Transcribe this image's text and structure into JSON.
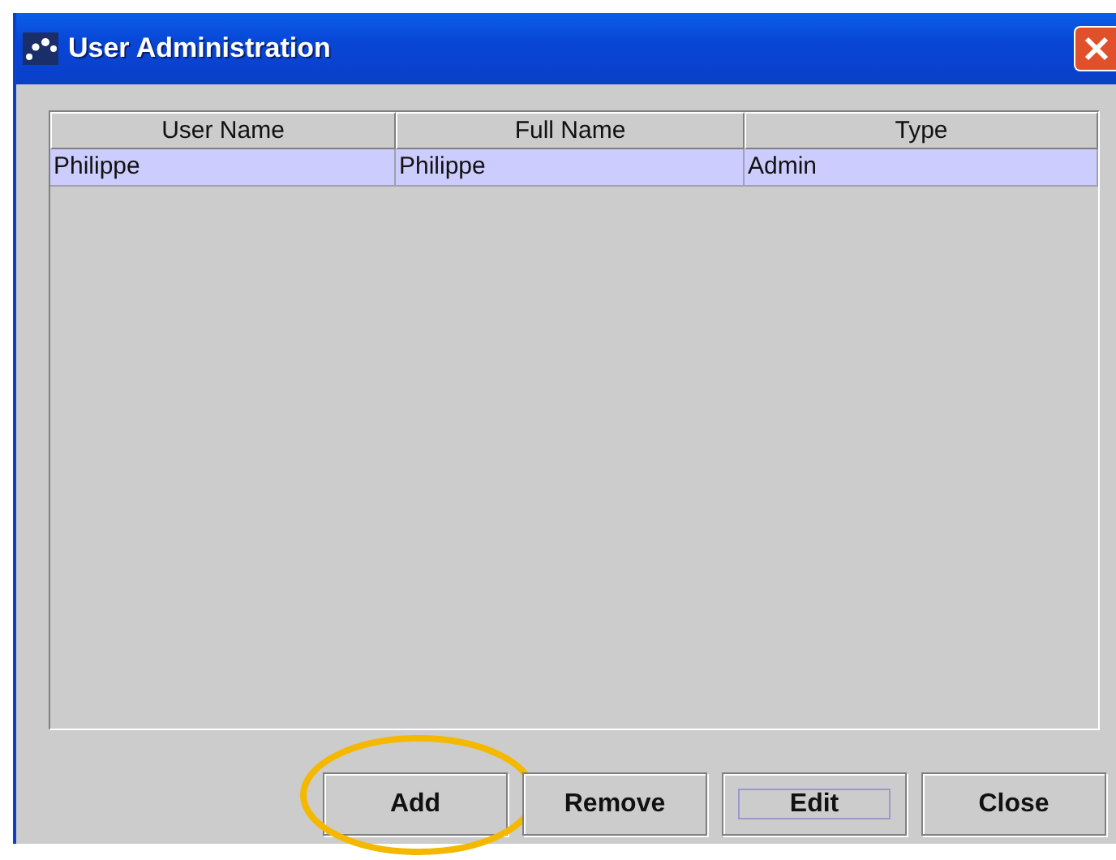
{
  "window": {
    "title": "User Administration"
  },
  "table": {
    "columns": [
      "User Name",
      "Full Name",
      "Type"
    ],
    "rows": [
      {
        "cells": [
          "Philippe",
          "Philippe",
          "Admin"
        ],
        "selected": true
      }
    ]
  },
  "buttons": [
    {
      "label": "Add",
      "focused": false,
      "highlighted": true
    },
    {
      "label": "Remove",
      "focused": false,
      "highlighted": false
    },
    {
      "label": "Edit",
      "focused": true,
      "highlighted": false
    },
    {
      "label": "Close",
      "focused": false,
      "highlighted": false
    }
  ]
}
